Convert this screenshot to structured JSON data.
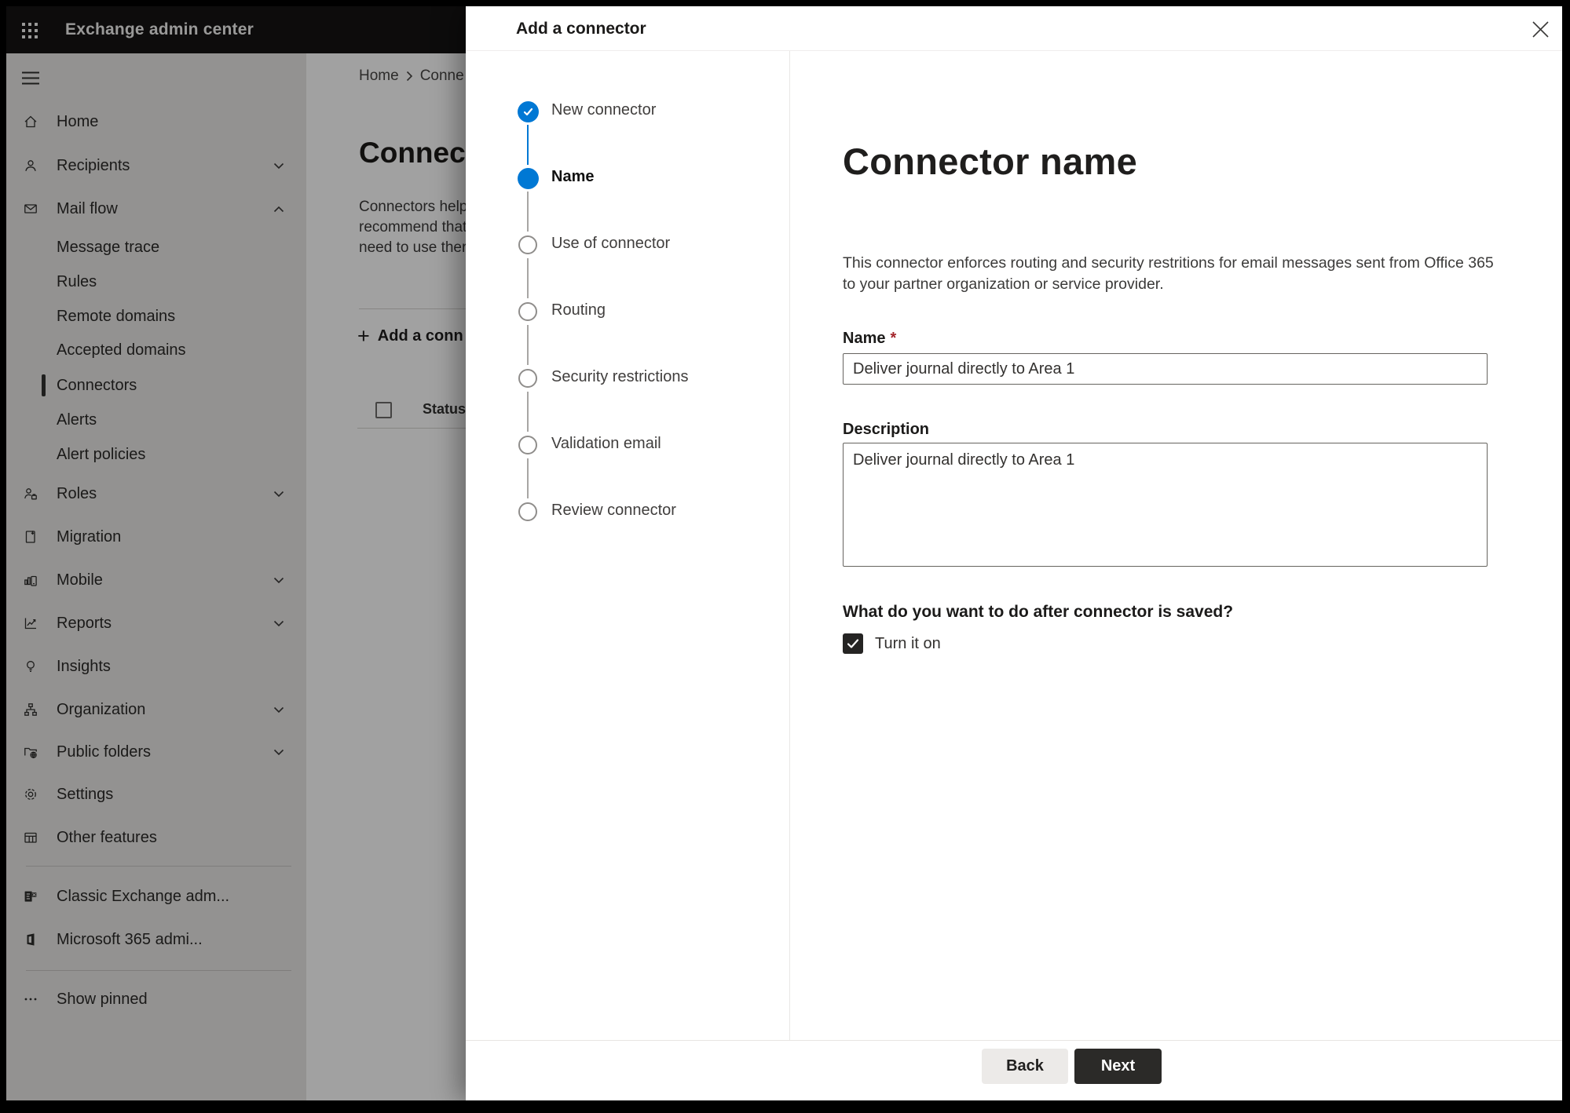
{
  "topbar": {
    "title": "Exchange admin center"
  },
  "sidebar": {
    "items": [
      {
        "type": "item",
        "label": "Home",
        "icon": "home"
      },
      {
        "type": "item",
        "label": "Recipients",
        "icon": "recipients",
        "chevron": "down"
      },
      {
        "type": "item",
        "label": "Mail flow",
        "icon": "mail-flow",
        "chevron": "up"
      },
      {
        "type": "sub",
        "label": "Message trace"
      },
      {
        "type": "sub",
        "label": "Rules"
      },
      {
        "type": "sub",
        "label": "Remote domains"
      },
      {
        "type": "sub",
        "label": "Accepted domains"
      },
      {
        "type": "sub",
        "label": "Connectors",
        "selected": true
      },
      {
        "type": "sub",
        "label": "Alerts"
      },
      {
        "type": "sub",
        "label": "Alert policies"
      },
      {
        "type": "item",
        "label": "Roles",
        "icon": "roles",
        "chevron": "down"
      },
      {
        "type": "item",
        "label": "Migration",
        "icon": "migration"
      },
      {
        "type": "item",
        "label": "Mobile",
        "icon": "mobile",
        "chevron": "down"
      },
      {
        "type": "item",
        "label": "Reports",
        "icon": "reports",
        "chevron": "down"
      },
      {
        "type": "item",
        "label": "Insights",
        "icon": "insights"
      },
      {
        "type": "item",
        "label": "Organization",
        "icon": "organization",
        "chevron": "down"
      },
      {
        "type": "item",
        "label": "Public folders",
        "icon": "public-folders",
        "chevron": "down"
      },
      {
        "type": "item",
        "label": "Settings",
        "icon": "settings"
      },
      {
        "type": "item",
        "label": "Other features",
        "icon": "other-features"
      },
      {
        "type": "divider"
      },
      {
        "type": "item",
        "label": "Classic Exchange adm...",
        "icon": "classic-exchange"
      },
      {
        "type": "item",
        "label": "Microsoft 365 admi...",
        "icon": "microsoft-365"
      },
      {
        "type": "divider"
      },
      {
        "type": "item",
        "label": "Show pinned",
        "icon": "show-pinned"
      }
    ]
  },
  "background": {
    "breadcrumb": {
      "home": "Home",
      "current": "Conne"
    },
    "heading": "Connect",
    "paragraph_lines": [
      "Connectors help",
      "recommend that",
      "need to use ther"
    ],
    "add_button_label": "Add a conn",
    "status_header": "Status"
  },
  "dialog": {
    "title": "Add a connector",
    "steps": [
      {
        "label": "New connector",
        "state": "completed"
      },
      {
        "label": "Name",
        "state": "current"
      },
      {
        "label": "Use of connector",
        "state": "upcoming"
      },
      {
        "label": "Routing",
        "state": "upcoming"
      },
      {
        "label": "Security restrictions",
        "state": "upcoming"
      },
      {
        "label": "Validation email",
        "state": "upcoming"
      },
      {
        "label": "Review connector",
        "state": "upcoming"
      }
    ],
    "content": {
      "title": "Connector name",
      "description_lines": [
        "This connector enforces routing and security restritions for email messages sent from Office 365",
        "to your partner organization or service provider."
      ],
      "name_label": "Name",
      "name_required_mark": "*",
      "name_value": "Deliver journal directly to Area 1",
      "description_label": "Description",
      "description_value": "Deliver journal directly to Area 1",
      "question": "What do you want to do after connector is saved?",
      "checkbox_label": "Turn it on",
      "checkbox_checked": true
    },
    "footer": {
      "back_label": "Back",
      "next_label": "Next"
    }
  },
  "colors": {
    "accent": "#0078d4",
    "checkbox_dark": "#252423",
    "next_button_bg": "#2b2a28",
    "back_button_bg": "#eceae8",
    "asterisk_red": "#a4262c"
  }
}
